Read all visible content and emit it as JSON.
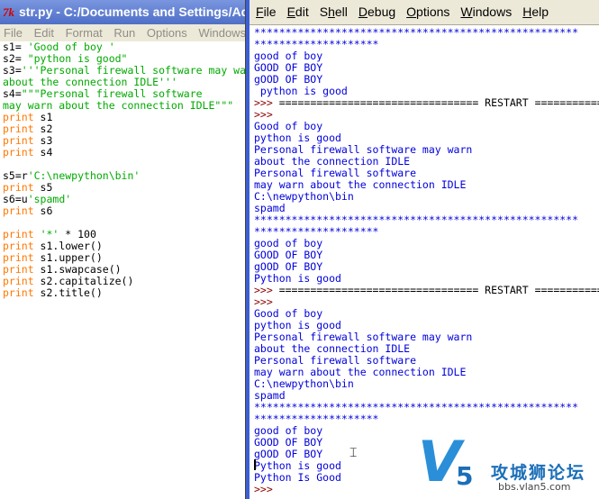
{
  "editor": {
    "app_icon": "7k",
    "title": "str.py - C:/Documents and Settings/Ad",
    "menu": [
      "File",
      "Edit",
      "Format",
      "Run",
      "Options",
      "Windows"
    ],
    "lines": [
      [
        [
          "plain",
          "s1= "
        ],
        [
          "str",
          "'Good of boy '"
        ]
      ],
      [
        [
          "plain",
          "s2= "
        ],
        [
          "str",
          "\"python is good\""
        ]
      ],
      [
        [
          "plain",
          "s3="
        ],
        [
          "str",
          "'''Personal firewall software may wa"
        ]
      ],
      [
        [
          "str",
          "about the connection IDLE'''"
        ]
      ],
      [
        [
          "plain",
          "s4="
        ],
        [
          "str",
          "\"\"\"Personal firewall software"
        ]
      ],
      [
        [
          "str",
          "may warn about the connection IDLE\"\"\""
        ]
      ],
      [
        [
          "kw",
          "print"
        ],
        [
          "plain",
          " s1"
        ]
      ],
      [
        [
          "kw",
          "print"
        ],
        [
          "plain",
          " s2"
        ]
      ],
      [
        [
          "kw",
          "print"
        ],
        [
          "plain",
          " s3"
        ]
      ],
      [
        [
          "kw",
          "print"
        ],
        [
          "plain",
          " s4"
        ]
      ],
      [
        [
          "plain",
          ""
        ]
      ],
      [
        [
          "plain",
          "s5=r"
        ],
        [
          "str",
          "'C:\\newpython\\bin'"
        ]
      ],
      [
        [
          "kw",
          "print"
        ],
        [
          "plain",
          " s5"
        ]
      ],
      [
        [
          "plain",
          "s6=u"
        ],
        [
          "str",
          "'spamd'"
        ]
      ],
      [
        [
          "kw",
          "print"
        ],
        [
          "plain",
          " s6"
        ]
      ],
      [
        [
          "plain",
          ""
        ]
      ],
      [
        [
          "kw",
          "print"
        ],
        [
          "plain",
          " "
        ],
        [
          "str",
          "'*'"
        ],
        [
          "plain",
          " * 100"
        ]
      ],
      [
        [
          "kw",
          "print"
        ],
        [
          "plain",
          " s1.lower()"
        ]
      ],
      [
        [
          "kw",
          "print"
        ],
        [
          "plain",
          " s1.upper()"
        ]
      ],
      [
        [
          "kw",
          "print"
        ],
        [
          "plain",
          " s1.swapcase()"
        ]
      ],
      [
        [
          "kw",
          "print"
        ],
        [
          "plain",
          " s2.capitalize()"
        ]
      ],
      [
        [
          "kw",
          "print"
        ],
        [
          "plain",
          " s2.title()"
        ]
      ]
    ]
  },
  "shell": {
    "menu": [
      {
        "label": "File",
        "u": "F"
      },
      {
        "label": "Edit",
        "u": "E"
      },
      {
        "label": "Shell",
        "u": "h"
      },
      {
        "label": "Debug",
        "u": "D"
      },
      {
        "label": "Options",
        "u": "O"
      },
      {
        "label": "Windows",
        "u": "W"
      },
      {
        "label": "Help",
        "u": "H"
      }
    ],
    "lines": [
      [
        [
          "blue",
          "****************************************************"
        ]
      ],
      [
        [
          "blue",
          "********************"
        ]
      ],
      [
        [
          "blue",
          "good of boy"
        ]
      ],
      [
        [
          "blue",
          "GOOD OF BOY"
        ]
      ],
      [
        [
          "blue",
          "gOOD OF BOY"
        ]
      ],
      [
        [
          "blue",
          " python is good"
        ]
      ],
      [
        [
          "prompt",
          ">>> "
        ],
        [
          "plain",
          "================================ RESTART ============"
        ]
      ],
      [
        [
          "prompt",
          ">>> "
        ]
      ],
      [
        [
          "blue",
          "Good of boy"
        ]
      ],
      [
        [
          "blue",
          "python is good"
        ]
      ],
      [
        [
          "blue",
          "Personal firewall software may warn"
        ]
      ],
      [
        [
          "blue",
          "about the connection IDLE"
        ]
      ],
      [
        [
          "blue",
          "Personal firewall software"
        ]
      ],
      [
        [
          "blue",
          "may warn about the connection IDLE"
        ]
      ],
      [
        [
          "blue",
          "C:\\newpython\\bin"
        ]
      ],
      [
        [
          "blue",
          "spamd"
        ]
      ],
      [
        [
          "blue",
          "****************************************************"
        ]
      ],
      [
        [
          "blue",
          "********************"
        ]
      ],
      [
        [
          "blue",
          "good of boy"
        ]
      ],
      [
        [
          "blue",
          "GOOD OF BOY"
        ]
      ],
      [
        [
          "blue",
          "gOOD OF BOY"
        ]
      ],
      [
        [
          "blue",
          "Python is good"
        ]
      ],
      [
        [
          "prompt",
          ">>> "
        ],
        [
          "plain",
          "================================ RESTART ============"
        ]
      ],
      [
        [
          "prompt",
          ">>> "
        ]
      ],
      [
        [
          "blue",
          "Good of boy"
        ]
      ],
      [
        [
          "blue",
          "python is good"
        ]
      ],
      [
        [
          "blue",
          "Personal firewall software may warn"
        ]
      ],
      [
        [
          "blue",
          "about the connection IDLE"
        ]
      ],
      [
        [
          "blue",
          "Personal firewall software"
        ]
      ],
      [
        [
          "blue",
          "may warn about the connection IDLE"
        ]
      ],
      [
        [
          "blue",
          "C:\\newpython\\bin"
        ]
      ],
      [
        [
          "blue",
          "spamd"
        ]
      ],
      [
        [
          "blue",
          "****************************************************"
        ]
      ],
      [
        [
          "blue",
          "********************"
        ]
      ],
      [
        [
          "blue",
          "good of boy"
        ]
      ],
      [
        [
          "blue",
          "GOOD OF BOY"
        ]
      ],
      [
        [
          "blue",
          "gOOD OF BOY"
        ]
      ],
      [
        [
          "blue",
          "Python is good"
        ]
      ],
      [
        [
          "blue",
          "Python Is Good"
        ]
      ],
      [
        [
          "prompt",
          ">>> "
        ]
      ]
    ]
  },
  "watermark": {
    "logo_letter": "V",
    "logo_number": "5",
    "site_name": "攻城狮论坛",
    "url": "bbs.vlan5.com"
  },
  "colors": {
    "keyword": "#ff7700",
    "string": "#00aa00",
    "output": "#0000dd",
    "prompt": "#8b0000"
  }
}
